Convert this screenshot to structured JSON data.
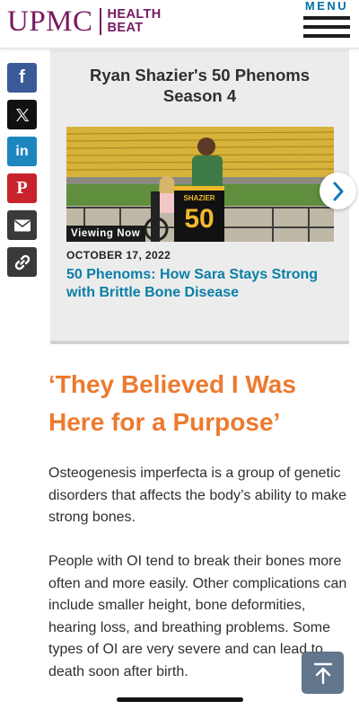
{
  "header": {
    "logo_text": "UPMC",
    "logo_sub_line1": "HEALTH",
    "logo_sub_line2": "BEAT",
    "menu_label": "MENU"
  },
  "share": [
    {
      "name": "facebook",
      "glyph": "f"
    },
    {
      "name": "x",
      "glyph": "𝕏"
    },
    {
      "name": "linkedin",
      "glyph": "in"
    },
    {
      "name": "pinterest",
      "glyph": "P"
    },
    {
      "name": "email",
      "glyph": ""
    },
    {
      "name": "copy-link",
      "glyph": ""
    }
  ],
  "video_card": {
    "title_line1": "Ryan Shazier's 50 Phenoms",
    "title_line2": "Season 4",
    "badge": "Viewing Now",
    "date": "OCTOBER 17, 2022",
    "headline": "50 Phenoms: How Sara Stays Strong with Brittle Bone Disease",
    "jersey_name": "SHAZIER",
    "jersey_number": "50"
  },
  "article": {
    "title": "‘They Believed I Was Here for a Purpose’",
    "paragraph1": "Osteogenesis imperfecta is a group of genetic disorders that affects the body’s ability to make strong bones.",
    "paragraph2": "People with OI tend to break their bones more often and more easily. Other complications can include smaller height, bone deformities, hearing loss, and breathing problems. Some types of OI are very severe and can lead to death soon after birth."
  },
  "colors": {
    "brand_purple": "#771b61",
    "title_orange": "#ec7a2f",
    "link_teal": "#0a7fa6",
    "menu_blue": "#0070a7"
  }
}
